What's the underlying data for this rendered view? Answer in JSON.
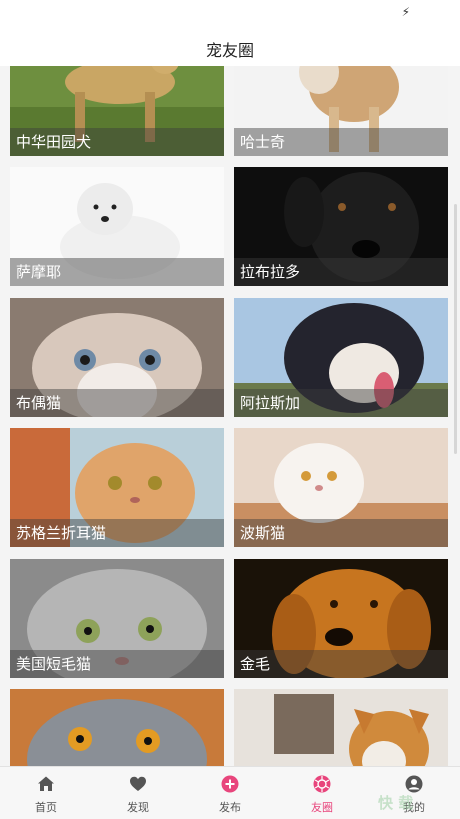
{
  "app": {
    "title": "宠友圈"
  },
  "status_bar": {
    "icon": "charging-bolt-icon"
  },
  "pets": [
    {
      "name": "中华田园犬",
      "kind": "dog"
    },
    {
      "name": "哈士奇",
      "kind": "dog"
    },
    {
      "name": "萨摩耶",
      "kind": "dog"
    },
    {
      "name": "拉布拉多",
      "kind": "dog"
    },
    {
      "name": "布偶猫",
      "kind": "cat"
    },
    {
      "name": "阿拉斯加",
      "kind": "dog"
    },
    {
      "name": "苏格兰折耳猫",
      "kind": "cat"
    },
    {
      "name": "波斯猫",
      "kind": "cat"
    },
    {
      "name": "美国短毛猫",
      "kind": "cat"
    },
    {
      "name": "金毛",
      "kind": "dog"
    },
    {
      "name": "",
      "kind": "cat"
    },
    {
      "name": "",
      "kind": "dog"
    }
  ],
  "tabs": [
    {
      "label": "首页",
      "icon": "home-icon",
      "active": false
    },
    {
      "label": "发现",
      "icon": "heart-icon",
      "active": false
    },
    {
      "label": "发布",
      "icon": "plus-circle-icon",
      "active": false
    },
    {
      "label": "友圈",
      "icon": "camera-aperture-icon",
      "active": true
    },
    {
      "label": "我的",
      "icon": "user-icon",
      "active": false
    }
  ],
  "colors": {
    "accent": "#e8457c",
    "tab_inactive": "#555555",
    "background": "#f4f4f4"
  },
  "watermark": {
    "text": "快 载"
  }
}
